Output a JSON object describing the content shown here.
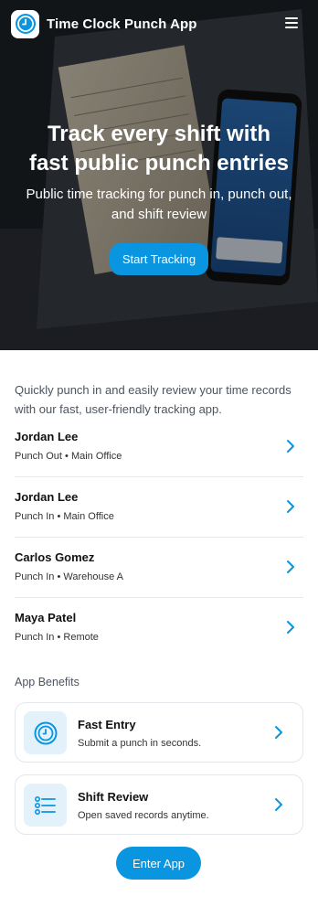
{
  "header": {
    "app_title": "Time Clock Punch App",
    "logo_icon": "clock-icon",
    "menu_icon": "hamburger-icon"
  },
  "hero": {
    "title_line1": "Track every shift with",
    "title_line2": "fast public punch entries",
    "subtitle": "Public time tracking for punch in, punch out, and shift review",
    "cta_label": "Start Tracking"
  },
  "intro": "Quickly punch in and easily review your time records with our fast, user-friendly tracking app.",
  "entries": [
    {
      "name": "Jordan Lee",
      "meta": "Punch Out • Main Office"
    },
    {
      "name": "Jordan Lee",
      "meta": "Punch In • Main Office"
    },
    {
      "name": "Carlos Gomez",
      "meta": "Punch In • Warehouse A"
    },
    {
      "name": "Maya Patel",
      "meta": "Punch In • Remote"
    }
  ],
  "benefits": {
    "label": "App Benefits",
    "items": [
      {
        "title": "Fast Entry",
        "desc": "Submit a punch in seconds.",
        "icon": "clock-icon"
      },
      {
        "title": "Shift Review",
        "desc": "Open saved records anytime.",
        "icon": "list-icon"
      }
    ]
  },
  "footer": {
    "cta_label": "Enter App"
  },
  "colors": {
    "accent": "#0a95e0",
    "icon_bg": "#e3f1fb",
    "text_muted": "#4c5560"
  }
}
